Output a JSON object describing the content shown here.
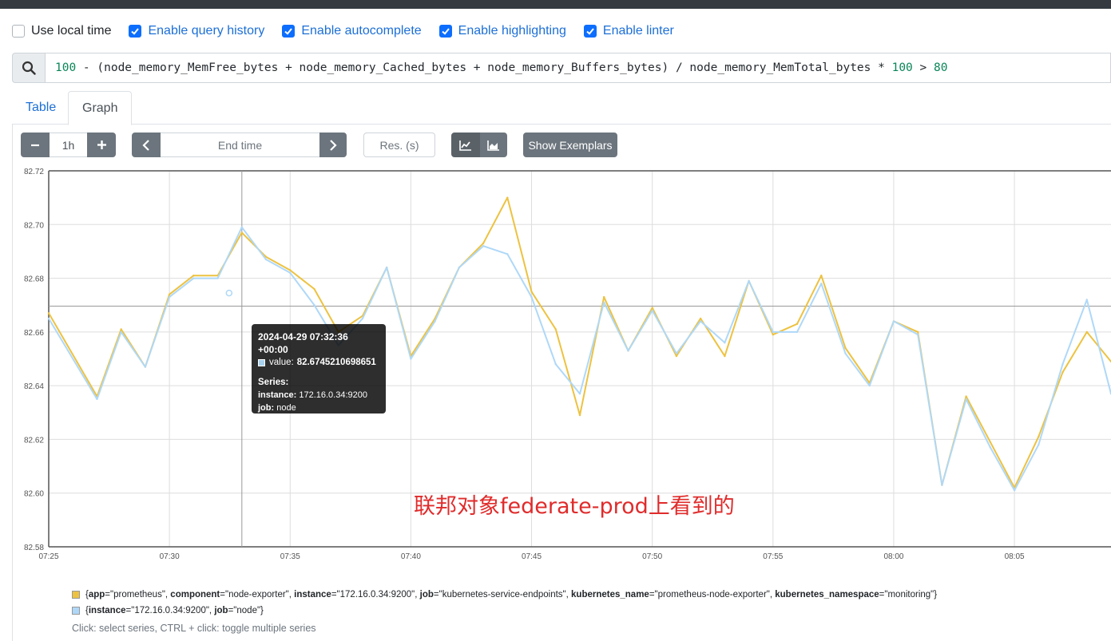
{
  "options": [
    {
      "label": "Use local time",
      "checked": false
    },
    {
      "label": "Enable query history",
      "checked": true
    },
    {
      "label": "Enable autocomplete",
      "checked": true
    },
    {
      "label": "Enable highlighting",
      "checked": true
    },
    {
      "label": "Enable linter",
      "checked": true
    }
  ],
  "query": {
    "icon": "search-icon",
    "tokens": [
      {
        "t": "100",
        "kind": "num"
      },
      {
        "t": " - (node_memory_MemFree_bytes + node_memory_Cached_bytes + node_memory_Buffers_bytes) / node_memory_MemTotal_bytes * ",
        "kind": "txt"
      },
      {
        "t": "100",
        "kind": "num"
      },
      {
        "t": " > ",
        "kind": "txt"
      },
      {
        "t": "80",
        "kind": "num"
      }
    ]
  },
  "tabs": {
    "table": "Table",
    "graph": "Graph",
    "active": "graph"
  },
  "controls": {
    "range_minus": "−",
    "range_value": "1h",
    "range_plus": "+",
    "end_prev": "‹",
    "end_placeholder": "End time",
    "end_next": "›",
    "resolution_placeholder": "Res. (s)",
    "chart_type": "line",
    "exemplars_label": "Show Exemplars"
  },
  "colors": {
    "series1": "#edc240",
    "series2": "#afd8f8",
    "grid": "#dddddd"
  },
  "chart_data": {
    "type": "line",
    "xlabel": "",
    "ylabel": "",
    "x_ticks": [
      "07:25",
      "07:30",
      "07:35",
      "07:40",
      "07:45",
      "07:50",
      "07:55",
      "08:00",
      "08:05"
    ],
    "y_ticks": [
      "82.58",
      "82.60",
      "82.62",
      "82.64",
      "82.66",
      "82.68",
      "82.70",
      "82.72"
    ],
    "ylim": [
      82.58,
      82.72
    ],
    "xlim": [
      "07:25",
      "08:09"
    ],
    "grid": true,
    "legend_position": "bottom",
    "crosshair_x": "07:33",
    "crosshair_y": 82.6696,
    "series": [
      {
        "name": "{app=\"prometheus\", component=\"node-exporter\", instance=\"172.16.0.34:9200\", job=\"kubernetes-service-endpoints\", kubernetes_name=\"prometheus-node-exporter\", kubernetes_namespace=\"monitoring\"}",
        "x": [
          "07:25",
          "07:27",
          "07:28",
          "07:29",
          "07:30",
          "07:31",
          "07:32",
          "07:33",
          "07:34",
          "07:35",
          "07:36",
          "07:37",
          "07:38",
          "07:39",
          "07:40",
          "07:41",
          "07:42",
          "07:43",
          "07:44",
          "07:45",
          "07:46",
          "07:47",
          "07:48",
          "07:49",
          "07:50",
          "07:51",
          "07:52",
          "07:53",
          "07:54",
          "07:55",
          "07:56",
          "07:57",
          "07:58",
          "07:59",
          "08:00",
          "08:01",
          "08:02",
          "08:03",
          "08:04",
          "08:05",
          "08:06",
          "08:07",
          "08:08",
          "08:09"
        ],
        "values": [
          82.667,
          82.636,
          82.661,
          82.647,
          82.674,
          82.681,
          82.681,
          82.697,
          82.688,
          82.683,
          82.676,
          82.66,
          82.666,
          82.684,
          82.651,
          82.665,
          82.684,
          82.693,
          82.71,
          82.675,
          82.661,
          82.629,
          82.673,
          82.653,
          82.669,
          82.651,
          82.665,
          82.651,
          82.679,
          82.659,
          82.663,
          82.681,
          82.654,
          82.641,
          82.664,
          82.66,
          82.603,
          82.636,
          82.619,
          82.602,
          82.621,
          82.645,
          82.66,
          82.649
        ]
      },
      {
        "name": "{instance=\"172.16.0.34:9200\", job=\"node\"}",
        "x": [
          "07:25",
          "07:27",
          "07:28",
          "07:29",
          "07:30",
          "07:31",
          "07:32",
          "07:33",
          "07:34",
          "07:35",
          "07:36",
          "07:37",
          "07:38",
          "07:39",
          "07:40",
          "07:41",
          "07:42",
          "07:43",
          "07:44",
          "07:45",
          "07:46",
          "07:47",
          "07:48",
          "07:49",
          "07:50",
          "07:51",
          "07:52",
          "07:53",
          "07:54",
          "07:55",
          "07:56",
          "07:57",
          "07:58",
          "07:59",
          "08:00",
          "08:01",
          "08:02",
          "08:03",
          "08:04",
          "08:05",
          "08:06",
          "08:07",
          "08:08",
          "08:09"
        ],
        "values": [
          82.665,
          82.635,
          82.66,
          82.647,
          82.673,
          82.68,
          82.68,
          82.699,
          82.687,
          82.682,
          82.67,
          82.655,
          82.665,
          82.684,
          82.65,
          82.664,
          82.684,
          82.692,
          82.689,
          82.673,
          82.648,
          82.637,
          82.671,
          82.653,
          82.668,
          82.652,
          82.664,
          82.656,
          82.679,
          82.66,
          82.66,
          82.678,
          82.652,
          82.64,
          82.664,
          82.659,
          82.603,
          82.635,
          82.617,
          82.601,
          82.618,
          82.648,
          82.672,
          82.637
        ]
      }
    ]
  },
  "tooltip": {
    "date": "2024-04-29 07:32:36 +00:00",
    "value_label": "value:",
    "value": "82.6745210698651",
    "series_heading": "Series:",
    "labels": [
      {
        "key": "instance:",
        "value": "172.16.0.34:9200"
      },
      {
        "key": "job:",
        "value": "node"
      }
    ]
  },
  "annotation": "联邦对象federate-prod上看到的",
  "legend": [
    {
      "color": "#edc240",
      "parts": [
        {
          "t": "{"
        },
        {
          "t": "app",
          "b": true
        },
        {
          "t": "=\"prometheus\", "
        },
        {
          "t": "component",
          "b": true
        },
        {
          "t": "=\"node-exporter\", "
        },
        {
          "t": "instance",
          "b": true
        },
        {
          "t": "=\"172.16.0.34:9200\", "
        },
        {
          "t": "job",
          "b": true
        },
        {
          "t": "=\"kubernetes-service-endpoints\", "
        },
        {
          "t": "kubernetes_name",
          "b": true
        },
        {
          "t": "=\"prometheus-node-exporter\", "
        },
        {
          "t": "kubernetes_namespace",
          "b": true
        },
        {
          "t": "=\"monitoring\"}"
        }
      ]
    },
    {
      "color": "#afd8f8",
      "parts": [
        {
          "t": "{"
        },
        {
          "t": "instance",
          "b": true
        },
        {
          "t": "=\"172.16.0.34:9200\", "
        },
        {
          "t": "job",
          "b": true
        },
        {
          "t": "=\"node\"}"
        }
      ]
    }
  ],
  "hint": "Click: select series, CTRL + click: toggle multiple series"
}
